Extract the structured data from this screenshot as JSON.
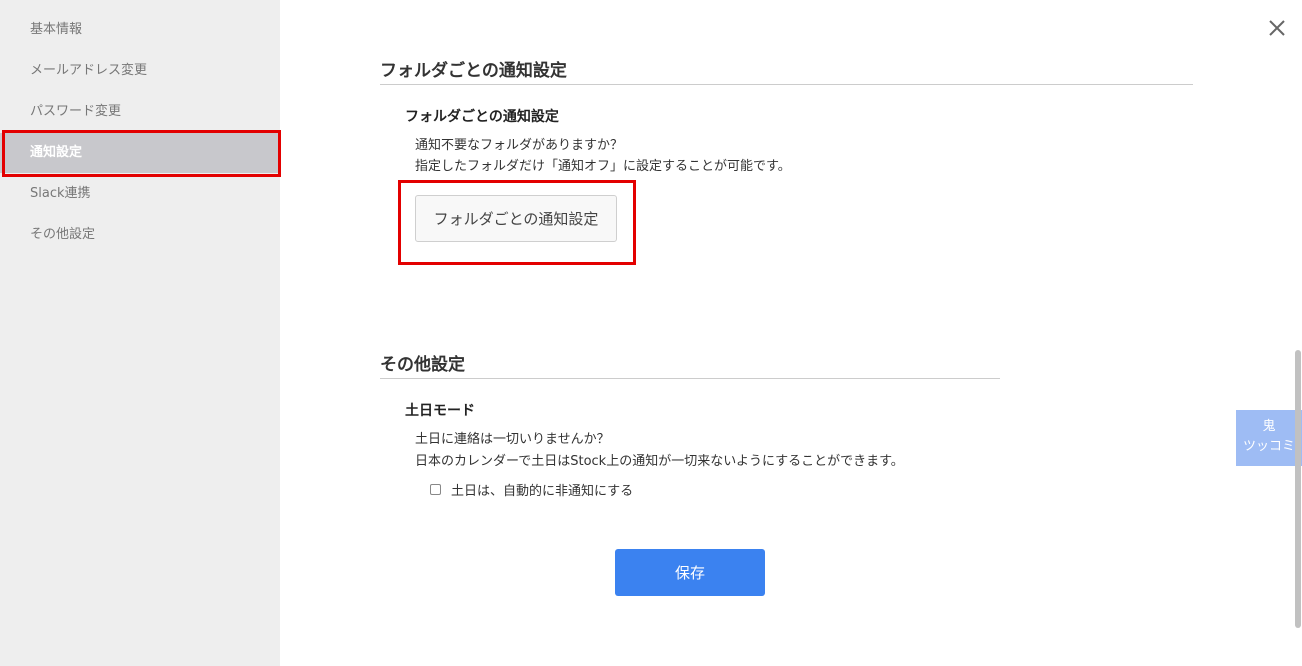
{
  "sidebar": {
    "items": [
      {
        "label": "基本情報"
      },
      {
        "label": "メールアドレス変更"
      },
      {
        "label": "パスワード変更"
      },
      {
        "label": "通知設定"
      },
      {
        "label": "Slack連携"
      },
      {
        "label": "その他設定"
      }
    ]
  },
  "folder_section": {
    "title": "フォルダごとの通知設定",
    "subtitle": "フォルダごとの通知設定",
    "desc1": "通知不要なフォルダがありますか？",
    "desc2": "指定したフォルダだけ「通知オフ」に設定することが可能です。",
    "button_label": "フォルダごとの通知設定"
  },
  "other_section": {
    "title": "その他設定",
    "subtitle": "土日モード",
    "desc1": "土日に連絡は一切いりませんか？",
    "desc2": "日本のカレンダーで土日はStock上の通知が一切来ないようにすることができます。",
    "checkbox_label": "土日は、自動的に非通知にする",
    "checkbox_checked": false
  },
  "save_label": "保存",
  "oni_widget": {
    "line1": "鬼",
    "line2": "ツッコミ"
  },
  "colors": {
    "accent": "#3b82f0",
    "highlight": "#e30000",
    "active_bg": "#c8c8cc"
  }
}
